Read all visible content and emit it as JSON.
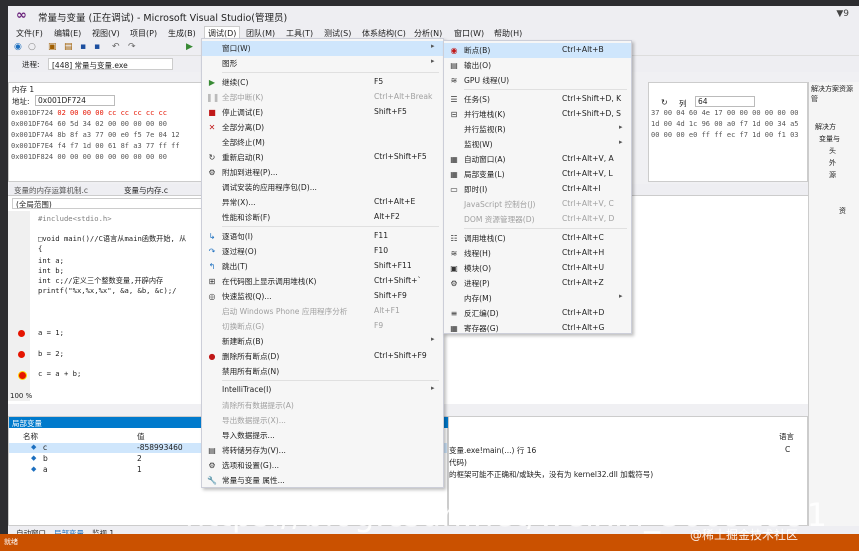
{
  "window": {
    "title": "常量与变量 (正在调试) - Microsoft Visual Studio(管理员)",
    "title_right": "▼9",
    "menu": [
      "文件(F)",
      "编辑(E)",
      "视图(V)",
      "项目(P)",
      "生成(B)",
      "调试(D)",
      "团队(M)",
      "工具(T)",
      "测试(S)",
      "体系结构(C)",
      "分析(N)",
      "窗口(W)",
      "帮助(H)"
    ]
  },
  "process": {
    "label": "进程:",
    "value": "[448] 常量与变量.exe"
  },
  "memory": {
    "title": "内存 1",
    "address_label": "地址:",
    "address": "0x001DF724",
    "column_label": "列",
    "columns": "64",
    "rows": [
      {
        "addr": "0x001DF724",
        "hex": "02 00 00 00 cc cc cc cc cc"
      },
      {
        "addr": "0x001DF764",
        "hex": "60 5d 34 02 00 00 00 00 00"
      },
      {
        "addr": "0x001DF7A4",
        "hex": "8b 8f a3 77 00 e0 f5 7e 04 12"
      },
      {
        "addr": "0x001DF7E4",
        "hex": "f4 f7 1d 00 61 8f a3 77 ff ff"
      },
      {
        "addr": "0x001DF824",
        "hex": "00 00 00 00 00 00 00 00 00"
      }
    ],
    "right_rows": [
      "37 00 04 60 4e 17 00 00 00 00 00 00",
      "1d 00 4d 1c 96 00 a0 f7 1d 00 34 a5",
      "00 00 00 e0 ff ff ec f7 1d 00 f1 03",
      "",
      ""
    ]
  },
  "editor": {
    "tabs": [
      "变量的内存运算机制.c",
      "变量与内存.c"
    ],
    "scope": "(全局范围)",
    "lines": [
      "#include<stdio.h>",
      "",
      "□void main()//C语言从main函数开始, 从",
      "{",
      "    int a;",
      "    int b;",
      "    int c;//定义三个整数变量,开辟内存",
      "    printf(\"%x,%x,%x\", &a, &b, &c);/",
      "",
      "",
      "    a = 1;",
      "",
      "    b = 2;",
      "",
      "    c = a + b;"
    ],
    "zoom": "100 %"
  },
  "locals": {
    "title": "局部变量",
    "col_name": "名称",
    "col_value": "值",
    "rows": [
      {
        "name": "c",
        "value": "-858993460"
      },
      {
        "name": "b",
        "value": "2"
      },
      {
        "name": "a",
        "value": "1"
      }
    ]
  },
  "output": {
    "lines": [
      "变量.exe!main(...) 行 16",
      "代码)",
      "的框架可能不正确和/或缺失，没有为 kernel32.dll 加载符号)"
    ],
    "col_lang": "语言",
    "lang": "C"
  },
  "solution": {
    "title": "解决方案资源管",
    "items": [
      "解决方",
      "变量与",
      "头",
      "外",
      "源",
      "资"
    ]
  },
  "bottom_tabs": [
    "自动窗口",
    "局部变量",
    "监视 1"
  ],
  "status": "就绪",
  "debug_menu": {
    "items": [
      {
        "label": "窗口(W)",
        "arrow": true,
        "highlight": true
      },
      {
        "label": "图形",
        "arrow": true
      },
      {
        "sep": true
      },
      {
        "label": "继续(C)",
        "shortcut": "F5",
        "icon": "play-icon"
      },
      {
        "label": "全部中断(K)",
        "shortcut": "Ctrl+Alt+Break",
        "disabled": true,
        "icon": "pause-icon"
      },
      {
        "label": "停止调试(E)",
        "shortcut": "Shift+F5",
        "icon": "stop-icon"
      },
      {
        "label": "全部分离(D)",
        "icon": "detach-icon"
      },
      {
        "label": "全部终止(M)"
      },
      {
        "label": "重新启动(R)",
        "shortcut": "Ctrl+Shift+F5",
        "icon": "restart-icon"
      },
      {
        "label": "附加到进程(P)...",
        "icon": "attach-icon"
      },
      {
        "label": "调试安装的应用程序包(D)..."
      },
      {
        "label": "异常(X)...",
        "shortcut": "Ctrl+Alt+E"
      },
      {
        "label": "性能和诊断(F)",
        "shortcut": "Alt+F2"
      },
      {
        "sep": true
      },
      {
        "label": "逐语句(I)",
        "shortcut": "F11",
        "icon": "step-into-icon"
      },
      {
        "label": "逐过程(O)",
        "shortcut": "F10",
        "icon": "step-over-icon"
      },
      {
        "label": "跳出(T)",
        "shortcut": "Shift+F11",
        "icon": "step-out-icon"
      },
      {
        "label": "在代码图上显示调用堆栈(K)",
        "shortcut": "Ctrl+Shift+`",
        "icon": "code-map-icon"
      },
      {
        "label": "快速监视(Q)...",
        "shortcut": "Shift+F9",
        "icon": "quickwatch-icon"
      },
      {
        "label": "启动 Windows Phone 应用程序分析",
        "shortcut": "Alt+F1",
        "disabled": true
      },
      {
        "label": "切换断点(G)",
        "shortcut": "F9",
        "disabled": true
      },
      {
        "label": "新建断点(B)",
        "arrow": true
      },
      {
        "label": "删除所有断点(D)",
        "shortcut": "Ctrl+Shift+F9",
        "icon": "delete-breakpoints-icon"
      },
      {
        "label": "禁用所有断点(N)"
      },
      {
        "sep": true
      },
      {
        "label": "IntelliTrace(I)",
        "arrow": true
      },
      {
        "label": "清除所有数据提示(A)",
        "disabled": true
      },
      {
        "label": "导出数据提示(X)...",
        "disabled": true
      },
      {
        "label": "导入数据提示..."
      },
      {
        "label": "将转储另存为(V)...",
        "icon": "save-dump-icon"
      },
      {
        "label": "选项和设置(G)...",
        "icon": "options-icon"
      },
      {
        "label": "常量与变量 属性...",
        "icon": "wrench-icon"
      }
    ]
  },
  "window_menu": {
    "items": [
      {
        "label": "断点(B)",
        "shortcut": "Ctrl+Alt+B",
        "highlight": true,
        "icon": "breakpoints-icon"
      },
      {
        "label": "输出(O)",
        "icon": "output-icon"
      },
      {
        "label": "GPU 线程(U)",
        "icon": "gpu-icon"
      },
      {
        "sep": true
      },
      {
        "label": "任务(S)",
        "shortcut": "Ctrl+Shift+D, K",
        "icon": "tasks-icon"
      },
      {
        "label": "并行堆栈(K)",
        "shortcut": "Ctrl+Shift+D, S",
        "icon": "parallel-stacks-icon"
      },
      {
        "label": "并行监视(R)",
        "arrow": true
      },
      {
        "label": "监视(W)",
        "arrow": true
      },
      {
        "label": "自动窗口(A)",
        "shortcut": "Ctrl+Alt+V, A",
        "icon": "autos-icon"
      },
      {
        "label": "局部变量(L)",
        "shortcut": "Ctrl+Alt+V, L",
        "icon": "locals-icon"
      },
      {
        "label": "即时(I)",
        "shortcut": "Ctrl+Alt+I",
        "icon": "immediate-icon"
      },
      {
        "label": "JavaScript 控制台(J)",
        "shortcut": "Ctrl+Alt+V, C",
        "disabled": true
      },
      {
        "label": "DOM 资源管理器(D)",
        "shortcut": "Ctrl+Alt+V, D",
        "disabled": true
      },
      {
        "sep": true
      },
      {
        "label": "调用堆栈(C)",
        "shortcut": "Ctrl+Alt+C",
        "icon": "call-stack-icon"
      },
      {
        "label": "线程(H)",
        "shortcut": "Ctrl+Alt+H",
        "icon": "threads-icon"
      },
      {
        "label": "模块(O)",
        "shortcut": "Ctrl+Alt+U",
        "icon": "modules-icon"
      },
      {
        "label": "进程(P)",
        "shortcut": "Ctrl+Alt+Z",
        "icon": "processes-icon"
      },
      {
        "label": "内存(M)",
        "arrow": true
      },
      {
        "label": "反汇编(D)",
        "shortcut": "Ctrl+Alt+D",
        "icon": "disassembly-icon"
      },
      {
        "label": "寄存器(G)",
        "shortcut": "Ctrl+Alt+G",
        "icon": "registers-icon"
      }
    ]
  },
  "watermark": "https://blog.csdn.net/weixin_36691991",
  "watermark2": "@稀土掘金技术社区"
}
